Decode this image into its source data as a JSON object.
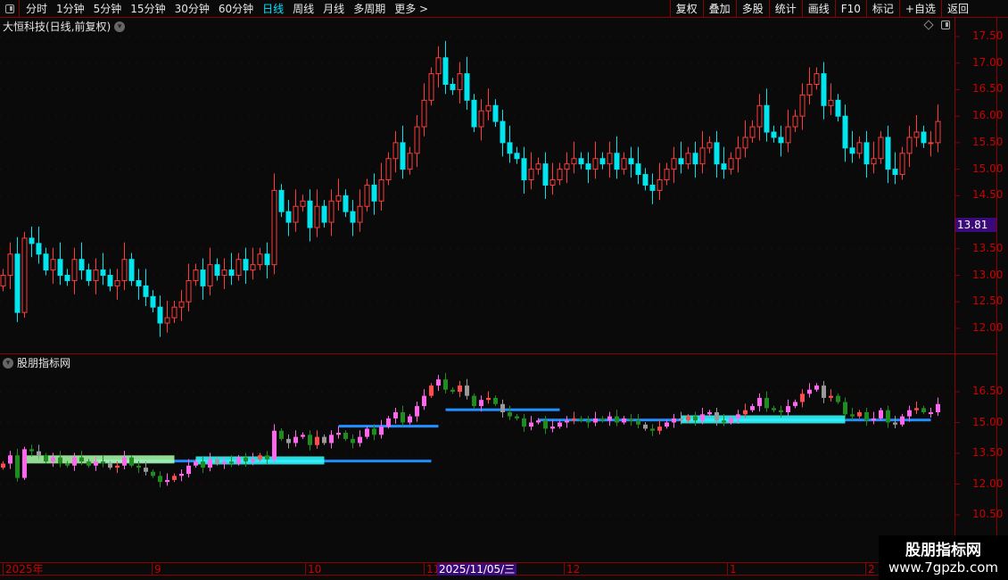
{
  "toolbar": {
    "periods": [
      "分时",
      "1分钟",
      "5分钟",
      "15分钟",
      "30分钟",
      "60分钟",
      "日线",
      "周线",
      "月线",
      "多周期",
      "更多 >"
    ],
    "active_period": "日线",
    "buttons": [
      "复权",
      "叠加",
      "多股",
      "统计",
      "画线",
      "F10",
      "标记",
      "+自选",
      "返回"
    ]
  },
  "main": {
    "title": "大恒科技(日线,前复权)",
    "current_price": "13.81",
    "price_labels": [
      "17.50",
      "17.00",
      "16.50",
      "16.00",
      "15.50",
      "15.00",
      "14.50",
      "13.50",
      "13.00",
      "12.50",
      "12.00"
    ]
  },
  "sub": {
    "title": "股朋指标网",
    "price_labels": [
      "16.50",
      "15.00",
      "13.50",
      "12.00",
      "10.50"
    ]
  },
  "time_axis": {
    "labels": [
      "2025年",
      "9",
      "10",
      "11",
      "12",
      "1",
      "2"
    ],
    "cursor_date": "2025/11/05/三"
  },
  "watermark": {
    "line1": "股朋指标网",
    "line2": "www.7gpzb.com"
  },
  "colors": {
    "up": "#ff3b3b",
    "down": "#00e5ee",
    "accent": "#00e6ff",
    "axis": "#cc0000",
    "highlight": "#3a0a7a"
  },
  "chart_data": {
    "type": "candlestick",
    "close": [
      13.0,
      13.4,
      12.3,
      13.7,
      13.6,
      13.4,
      13.1,
      13.3,
      13.0,
      12.9,
      13.3,
      13.1,
      12.9,
      13.1,
      13.0,
      12.8,
      12.9,
      13.3,
      12.9,
      12.8,
      12.6,
      12.4,
      12.1,
      12.2,
      12.4,
      12.5,
      12.9,
      13.1,
      12.8,
      13.2,
      13.0,
      13.1,
      13.0,
      13.3,
      13.1,
      13.2,
      13.4,
      13.2,
      14.6,
      14.2,
      14.0,
      14.3,
      14.4,
      13.9,
      14.3,
      14.0,
      14.4,
      14.5,
      14.2,
      14.0,
      14.3,
      14.7,
      14.4,
      14.8,
      15.2,
      15.5,
      15.0,
      15.3,
      15.8,
      16.3,
      16.8,
      17.1,
      16.6,
      16.5,
      16.8,
      16.3,
      15.8,
      16.1,
      16.2,
      15.9,
      15.5,
      15.3,
      15.2,
      14.8,
      15.0,
      15.1,
      14.7,
      14.8,
      15.0,
      15.1,
      15.2,
      15.1,
      15.0,
      15.2,
      15.1,
      15.3,
      15.0,
      15.2,
      15.1,
      14.9,
      14.7,
      14.6,
      14.8,
      15.0,
      15.2,
      15.1,
      15.3,
      15.1,
      15.4,
      15.5,
      15.1,
      15.0,
      15.2,
      15.4,
      15.6,
      15.8,
      16.2,
      15.7,
      15.6,
      15.5,
      15.8,
      16.0,
      16.4,
      16.6,
      16.8,
      16.2,
      16.3,
      16.0,
      15.4,
      15.3,
      15.5,
      15.1,
      15.2,
      15.6,
      15.0,
      14.9,
      15.3,
      15.6,
      15.7,
      15.5,
      15.5,
      15.9
    ],
    "first_open": 12.8,
    "ylim_main": [
      11.8,
      17.6
    ],
    "ylim_sub": [
      10.0,
      17.0
    ],
    "sub_lines": [
      {
        "from": 13,
        "to": 60,
        "value": 13.1
      },
      {
        "from": 47,
        "to": 61,
        "value": 14.8
      },
      {
        "from": 62,
        "to": 78,
        "value": 15.6
      },
      {
        "from": 75,
        "to": 130,
        "value": 15.1
      }
    ]
  }
}
